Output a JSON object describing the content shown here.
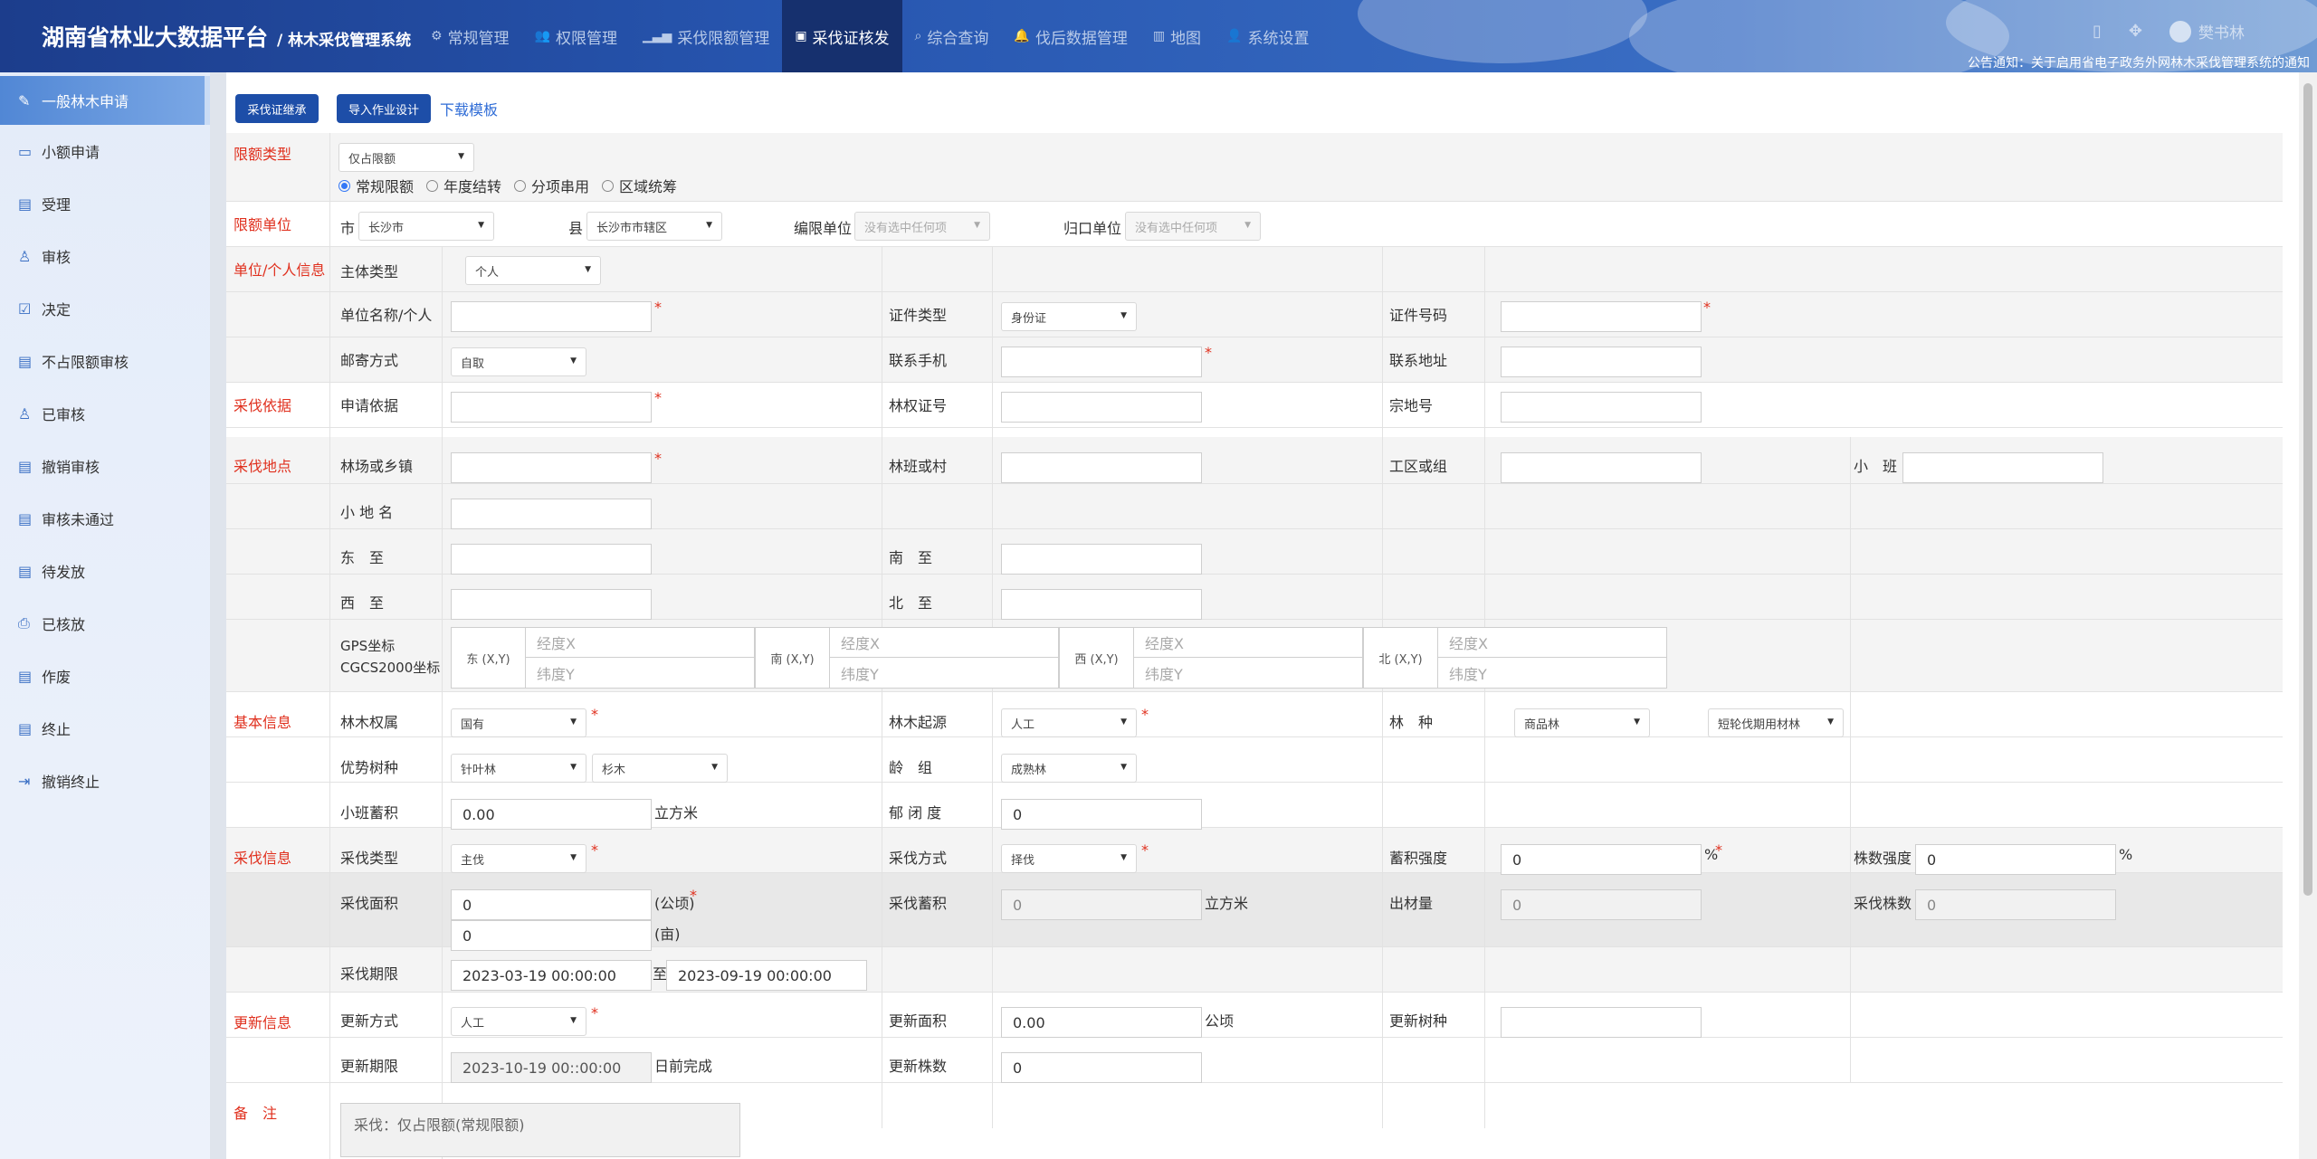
{
  "header": {
    "title": "湖南省林业大数据平台",
    "subtitle": "/ 林木采伐管理系统",
    "nav": [
      {
        "label": "常规管理",
        "icon": "gears-icon"
      },
      {
        "label": "权限管理",
        "icon": "users-icon"
      },
      {
        "label": "采伐限额管理",
        "icon": "bar-chart-icon"
      },
      {
        "label": "采伐证核发",
        "icon": "id-card-icon"
      },
      {
        "label": "综合查询",
        "icon": "search-icon"
      },
      {
        "label": "伐后数据管理",
        "icon": "bell-icon"
      },
      {
        "label": "地图",
        "icon": "map-icon"
      },
      {
        "label": "系统设置",
        "icon": "user-icon"
      }
    ],
    "active_nav": "采伐证核发",
    "user": "樊书林",
    "notice": "公告通知：关于启用省电子政务外网林木采伐管理系统的通知"
  },
  "sidebar": {
    "items": [
      {
        "label": "一般林木申请",
        "icon": "edit-doc-icon"
      },
      {
        "label": "小额申请",
        "icon": "monitor-icon"
      },
      {
        "label": "受理",
        "icon": "doc-icon"
      },
      {
        "label": "审核",
        "icon": "user-check-icon"
      },
      {
        "label": "决定",
        "icon": "check-square-icon"
      },
      {
        "label": "不占限额审核",
        "icon": "doc-gear-icon"
      },
      {
        "label": "已审核",
        "icon": "user-check-icon"
      },
      {
        "label": "撤销审核",
        "icon": "doc-undo-icon"
      },
      {
        "label": "审核未通过",
        "icon": "doc-x-icon"
      },
      {
        "label": "待发放",
        "icon": "list-doc-icon"
      },
      {
        "label": "已核放",
        "icon": "printer-icon"
      },
      {
        "label": "作废",
        "icon": "doc-ban-icon"
      },
      {
        "label": "终止",
        "icon": "doc-stop-icon"
      },
      {
        "label": "撤销终止",
        "icon": "sign-in-icon"
      }
    ]
  },
  "toolbar": {
    "btn_inherit": "采伐证继承",
    "btn_import": "导入作业设计",
    "link_template": "下载模板"
  },
  "quota_type": {
    "section": "限额类型",
    "select": "仅占限额",
    "radios": [
      "常规限额",
      "年度结转",
      "分项串用",
      "区域统筹"
    ],
    "selected_radio": "常规限额"
  },
  "quota_unit": {
    "section": "限额单位",
    "city_label": "市",
    "city": "长沙市",
    "county_label": "县",
    "county": "长沙市市辖区",
    "bianxian_label": "编限单位",
    "bianxian_placeholder": "没有选中任何项",
    "guikou_label": "归口单位",
    "guikou_placeholder": "没有选中任何项"
  },
  "applicant": {
    "section": "单位/个人信息",
    "subject_type_label": "主体类型",
    "subject_type": "个人",
    "name_label": "单位名称/个人",
    "name": "",
    "id_type_label": "证件类型",
    "id_type": "身份证",
    "id_no_label": "证件号码",
    "id_no": "",
    "mail_label": "邮寄方式",
    "mail": "自取",
    "phone_label": "联系手机",
    "phone": "",
    "address_label": "联系地址",
    "address": ""
  },
  "basis": {
    "section": "采伐依据",
    "apply_basis_label": "申请依据",
    "apply_basis": "",
    "forest_cert_label": "林权证号",
    "forest_cert": "",
    "parcel_label": "宗地号",
    "parcel": ""
  },
  "location": {
    "section": "采伐地点",
    "farm_label": "林场或乡镇",
    "farm": "",
    "village_label": "林班或村",
    "village": "",
    "work_area_label": "工区或组",
    "work_area": "",
    "subcompartment_label": "小　班",
    "subcompartment": "",
    "place_name_label": "小 地 名",
    "place_name": "",
    "east_label": "东　至",
    "east": "",
    "south_label": "南　至",
    "south": "",
    "west_label": "西　至",
    "west": "",
    "north_label": "北　至",
    "north": "",
    "gps_label": "GPS坐标",
    "cgcs_label": "CGCS2000坐标",
    "gps": [
      {
        "dir": "东 (X,Y)",
        "x_ph": "经度X",
        "y_ph": "纬度Y"
      },
      {
        "dir": "南 (X,Y)",
        "x_ph": "经度X",
        "y_ph": "纬度Y"
      },
      {
        "dir": "西 (X,Y)",
        "x_ph": "经度X",
        "y_ph": "纬度Y"
      },
      {
        "dir": "北 (X,Y)",
        "x_ph": "经度X",
        "y_ph": "纬度Y"
      }
    ]
  },
  "basic": {
    "section": "基本信息",
    "ownership_label": "林木权属",
    "ownership": "国有",
    "origin_label": "林木起源",
    "origin": "人工",
    "species_label": "林　种",
    "species_1": "商品林",
    "species_2": "短轮伐期用材林",
    "dominant_label": "优势树种",
    "dominant_1": "针叶林",
    "dominant_2": "杉木",
    "age_label": "龄　组",
    "age": "成熟林",
    "volume_label": "小班蓄积",
    "volume": "0.00",
    "volume_unit": "立方米",
    "canopy_label": "郁 闭 度",
    "canopy": "0"
  },
  "harvest": {
    "section": "采伐信息",
    "type_label": "采伐类型",
    "type": "主伐",
    "method_label": "采伐方式",
    "method": "择伐",
    "intensity_label": "蓄积强度",
    "intensity": "0",
    "intensity_unit": "%",
    "stem_intensity_label": "株数强度",
    "stem_intensity": "0",
    "stem_intensity_unit": "%",
    "area_label": "采伐面积",
    "area_ha": "0",
    "area_ha_unit": "(公顷)",
    "area_mu": "0",
    "area_mu_unit": "(亩)",
    "harvest_volume_label": "采伐蓄积",
    "harvest_volume": "0",
    "harvest_volume_unit": "立方米",
    "output_label": "出材量",
    "output": "0",
    "stem_count_label": "采伐株数",
    "stem_count": "0",
    "period_label": "采伐期限",
    "period_start": "2023-03-19 00:00:00",
    "period_to": "至",
    "period_end": "2023-09-19 00:00:00"
  },
  "renewal": {
    "section": "更新信息",
    "method_label": "更新方式",
    "method": "人工",
    "area_label": "更新面积",
    "area": "0.00",
    "area_unit": "公顷",
    "species_label": "更新树种",
    "species": "",
    "deadline_label": "更新期限",
    "deadline": "2023-10-19 00::00:00",
    "deadline_suffix": "日前完成",
    "count_label": "更新株数",
    "count": "0"
  },
  "remarks": {
    "section": "备　注",
    "text": "采伐：仅占限额(常规限额)"
  }
}
